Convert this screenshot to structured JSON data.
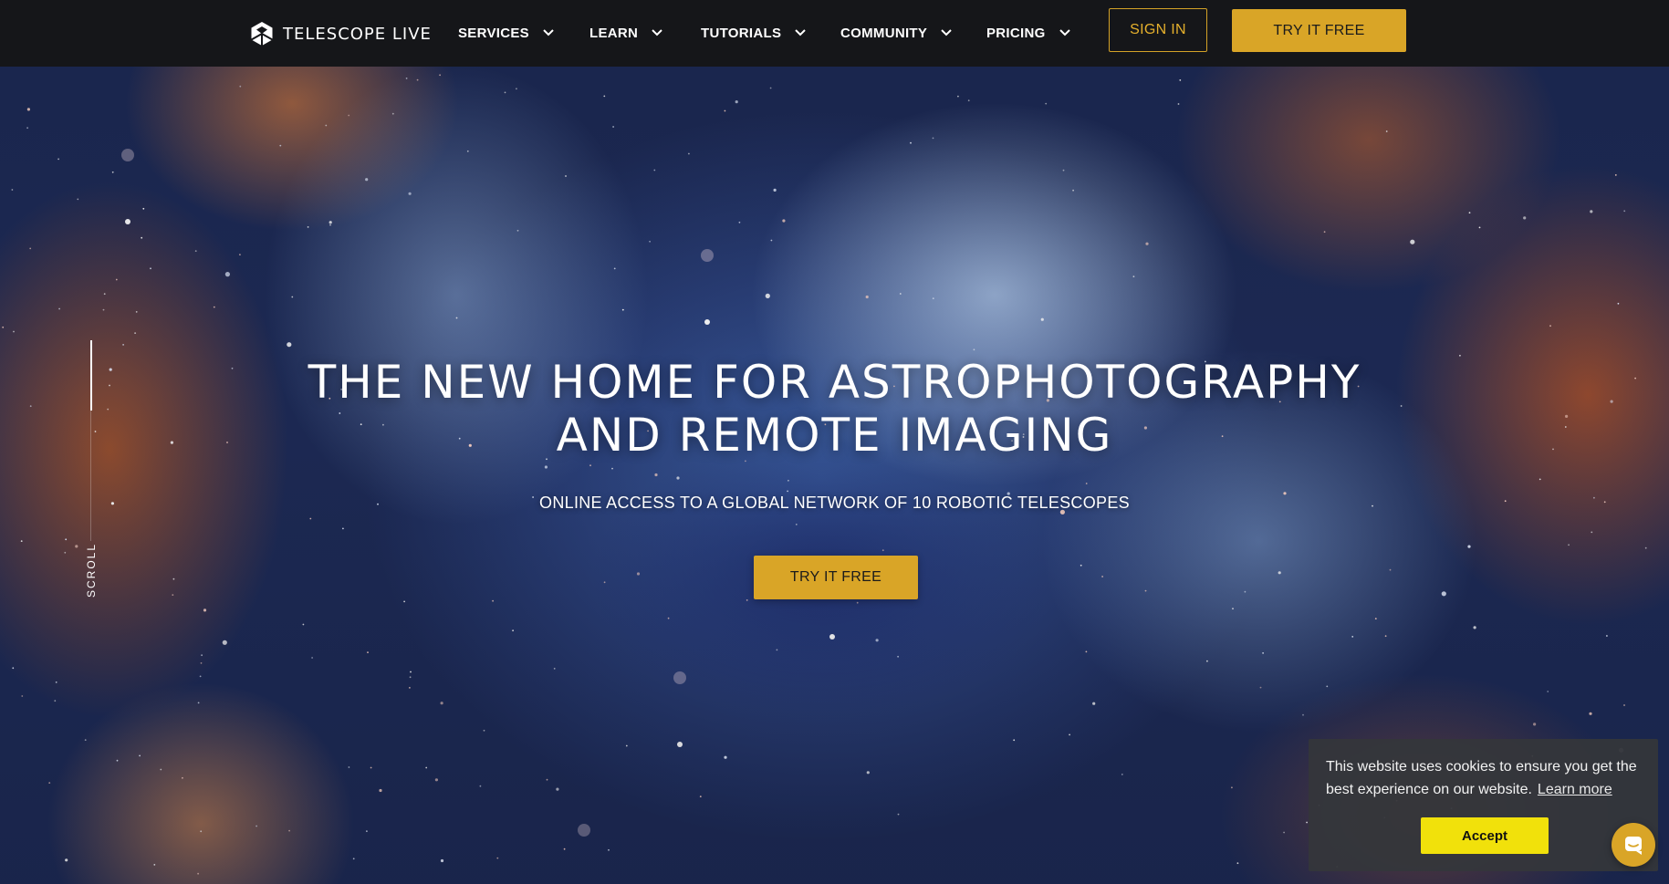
{
  "navbar": {
    "brand": "TELESCOPE LIVE",
    "menu": [
      {
        "label": "SERVICES"
      },
      {
        "label": "LEARN"
      },
      {
        "label": "TUTORIALS"
      },
      {
        "label": "COMMUNITY"
      },
      {
        "label": "PRICING"
      }
    ],
    "sign_in_label": "SIGN IN",
    "try_free_label": "TRY IT FREE"
  },
  "hero": {
    "headline_line1": "THE NEW HOME FOR ASTROPHOTOGRAPHY",
    "headline_line2": "AND REMOTE IMAGING",
    "subheadline": "ONLINE ACCESS TO A GLOBAL NETWORK OF 10 ROBOTIC TELESCOPES",
    "cta_label": "TRY IT FREE",
    "scroll_label": "SCROLL",
    "scroll_progress": 0.35
  },
  "cookie_banner": {
    "message": "This website uses cookies to ensure you get the best experience on our website.",
    "learn_more_label": "Learn more",
    "accept_label": "Accept"
  },
  "colors": {
    "accent_gold": "#d9a527",
    "accept_yellow": "#f1e10b",
    "navbar_bg": "#151619"
  },
  "icons": {
    "brand": "telescope-live-logo-icon",
    "menu_chevron": "chevron-down-icon",
    "chat": "chat-bubble-icon"
  }
}
